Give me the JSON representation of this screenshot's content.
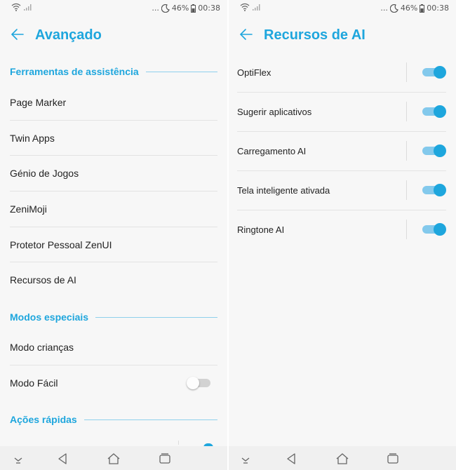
{
  "colors": {
    "accent": "#1ea6dd",
    "divider": "#e3e3e3",
    "background": "#f7f7f7"
  },
  "left": {
    "status": {
      "battery": "46%",
      "time": "00:38",
      "dots": "...",
      "icons": [
        "wifi-icon",
        "signal-icon",
        "moon-icon",
        "battery-icon"
      ]
    },
    "title": "Avançado",
    "sections": [
      {
        "title": "Ferramentas de assistência",
        "items": [
          "Page Marker",
          "Twin Apps",
          "Génio de Jogos",
          "ZeniMoji",
          "Protetor Pessoal ZenUI",
          "Recursos de AI"
        ]
      },
      {
        "title": "Modos especiais",
        "items": [
          "Modo crianças",
          "Modo Fácil"
        ]
      },
      {
        "title": "Ações rápidas",
        "items": []
      }
    ],
    "toggles": {
      "modo_facil": false
    }
  },
  "right": {
    "status": {
      "battery": "46%",
      "time": "00:38",
      "dots": "..."
    },
    "title": "Recursos de AI",
    "items": [
      {
        "label": "OptiFlex",
        "enabled": true
      },
      {
        "label": "Sugerir aplicativos",
        "enabled": true
      },
      {
        "label": "Carregamento AI",
        "enabled": true
      },
      {
        "label": "Tela inteligente ativada",
        "enabled": true
      },
      {
        "label": "Ringtone AI",
        "enabled": true
      }
    ]
  },
  "navbar": [
    "expand-icon",
    "back-icon",
    "home-icon",
    "recents-icon"
  ]
}
